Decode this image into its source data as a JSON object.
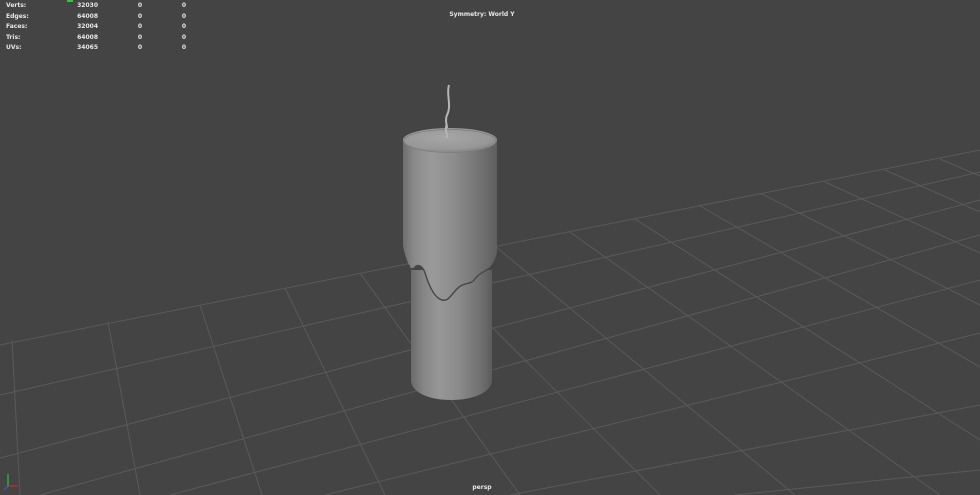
{
  "hud": {
    "rows": [
      {
        "label": "Verts:",
        "v1": "32030",
        "v2": "0",
        "v3": "0"
      },
      {
        "label": "Edges:",
        "v1": "64008",
        "v2": "0",
        "v3": "0"
      },
      {
        "label": "Faces:",
        "v1": "32004",
        "v2": "0",
        "v3": "0"
      },
      {
        "label": "Tris:",
        "v1": "64008",
        "v2": "0",
        "v3": "0"
      },
      {
        "label": "UVs:",
        "v1": "34065",
        "v2": "0",
        "v3": "0"
      }
    ]
  },
  "symmetry": "Symmetry: World Y",
  "camera": "persp",
  "colors": {
    "background": "#444444",
    "grid": "#5a5a5a",
    "axis_x": "#d22525",
    "axis_y": "#2ec12e",
    "axis_z": "#3a5bd9"
  },
  "icons": {
    "axis_gizmo": "xyz-axis-icon"
  }
}
